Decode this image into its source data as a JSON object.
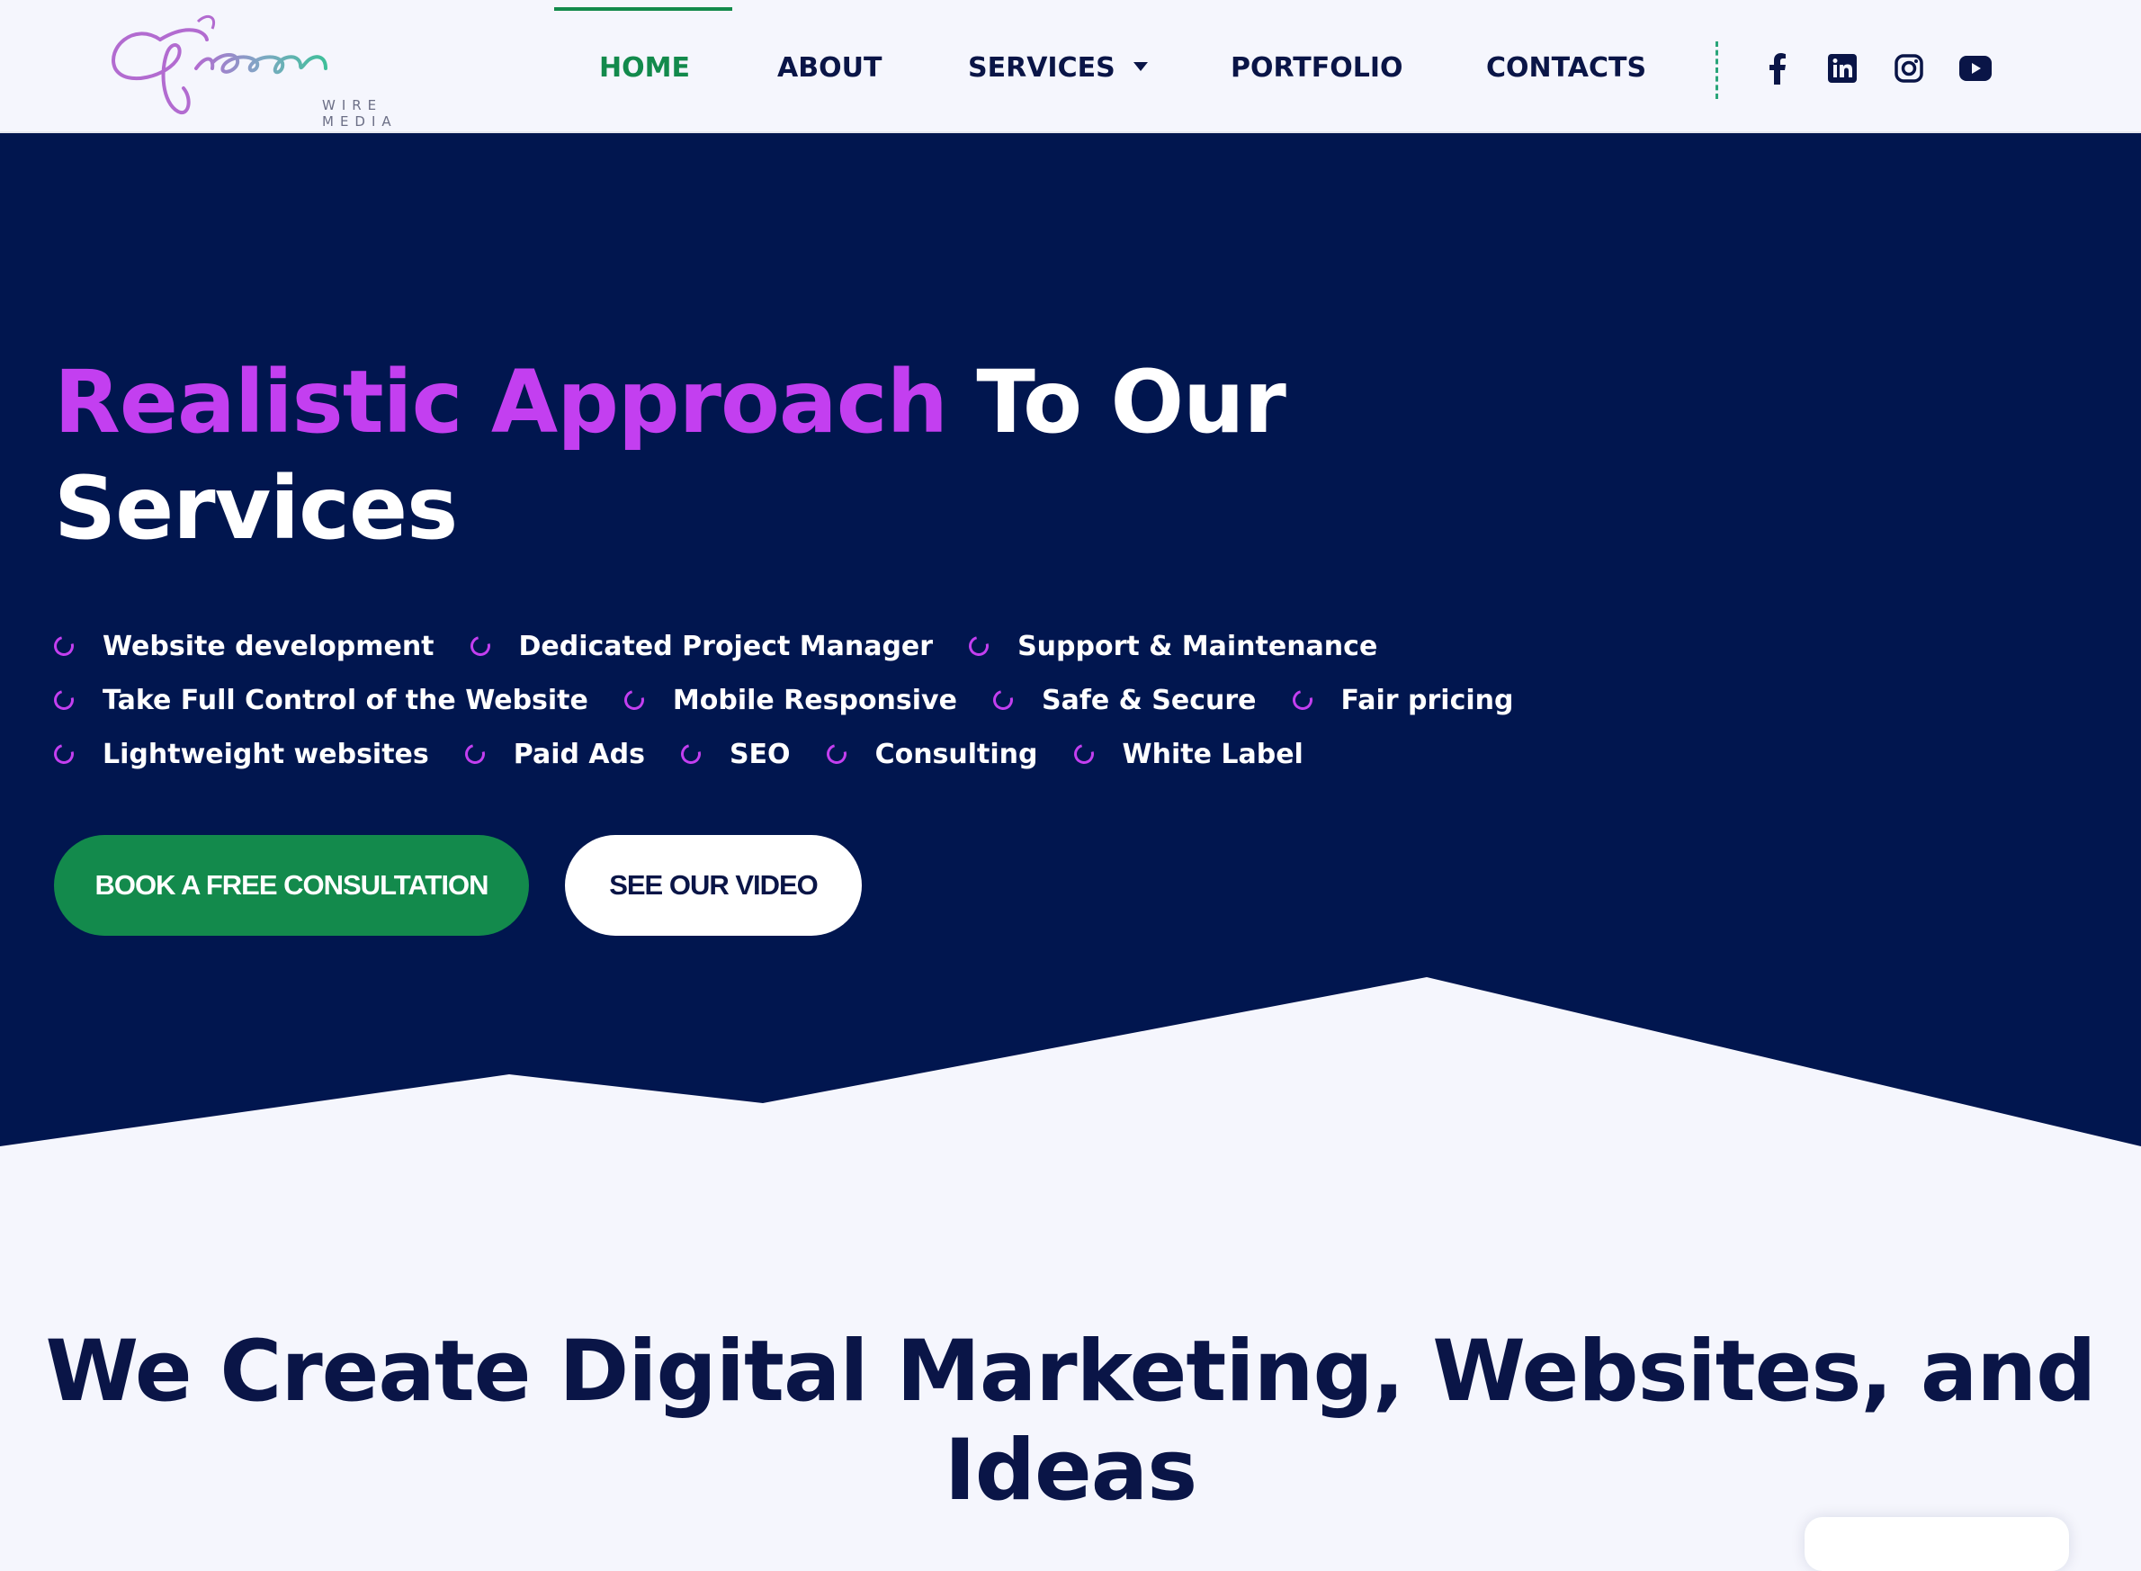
{
  "brand": {
    "logo_script": "Green",
    "logo_sub": "WIRE MEDIA"
  },
  "nav": {
    "items": [
      {
        "label": "HOME",
        "active": true
      },
      {
        "label": "ABOUT",
        "active": false
      },
      {
        "label": "SERVICES",
        "active": false,
        "has_dropdown": true
      },
      {
        "label": "PORTFOLIO",
        "active": false
      },
      {
        "label": "CONTACTS",
        "active": false
      }
    ],
    "social": [
      "facebook-icon",
      "linkedin-icon",
      "instagram-icon",
      "youtube-icon"
    ]
  },
  "hero": {
    "title_accent": "Realistic Approach",
    "title_rest": " To Our Services",
    "features": [
      [
        "Website development",
        "Dedicated Project Manager",
        "Support & Maintenance"
      ],
      [
        "Take Full Control of the Website",
        "Mobile Responsive",
        "Safe & Secure",
        "Fair pricing"
      ],
      [
        "Lightweight websites",
        "Paid Ads",
        "SEO",
        "Consulting",
        "White Label"
      ]
    ],
    "primary_cta": "BOOK A FREE CONSULTATION",
    "secondary_cta": "SEE OUR VIDEO"
  },
  "section": {
    "title": "We Create Digital Marketing, Websites, and Ideas"
  },
  "colors": {
    "navy": "#01164f",
    "accent_purple": "#c33ff0",
    "brand_green": "#138a4c",
    "page_bg": "#f5f6fd"
  }
}
